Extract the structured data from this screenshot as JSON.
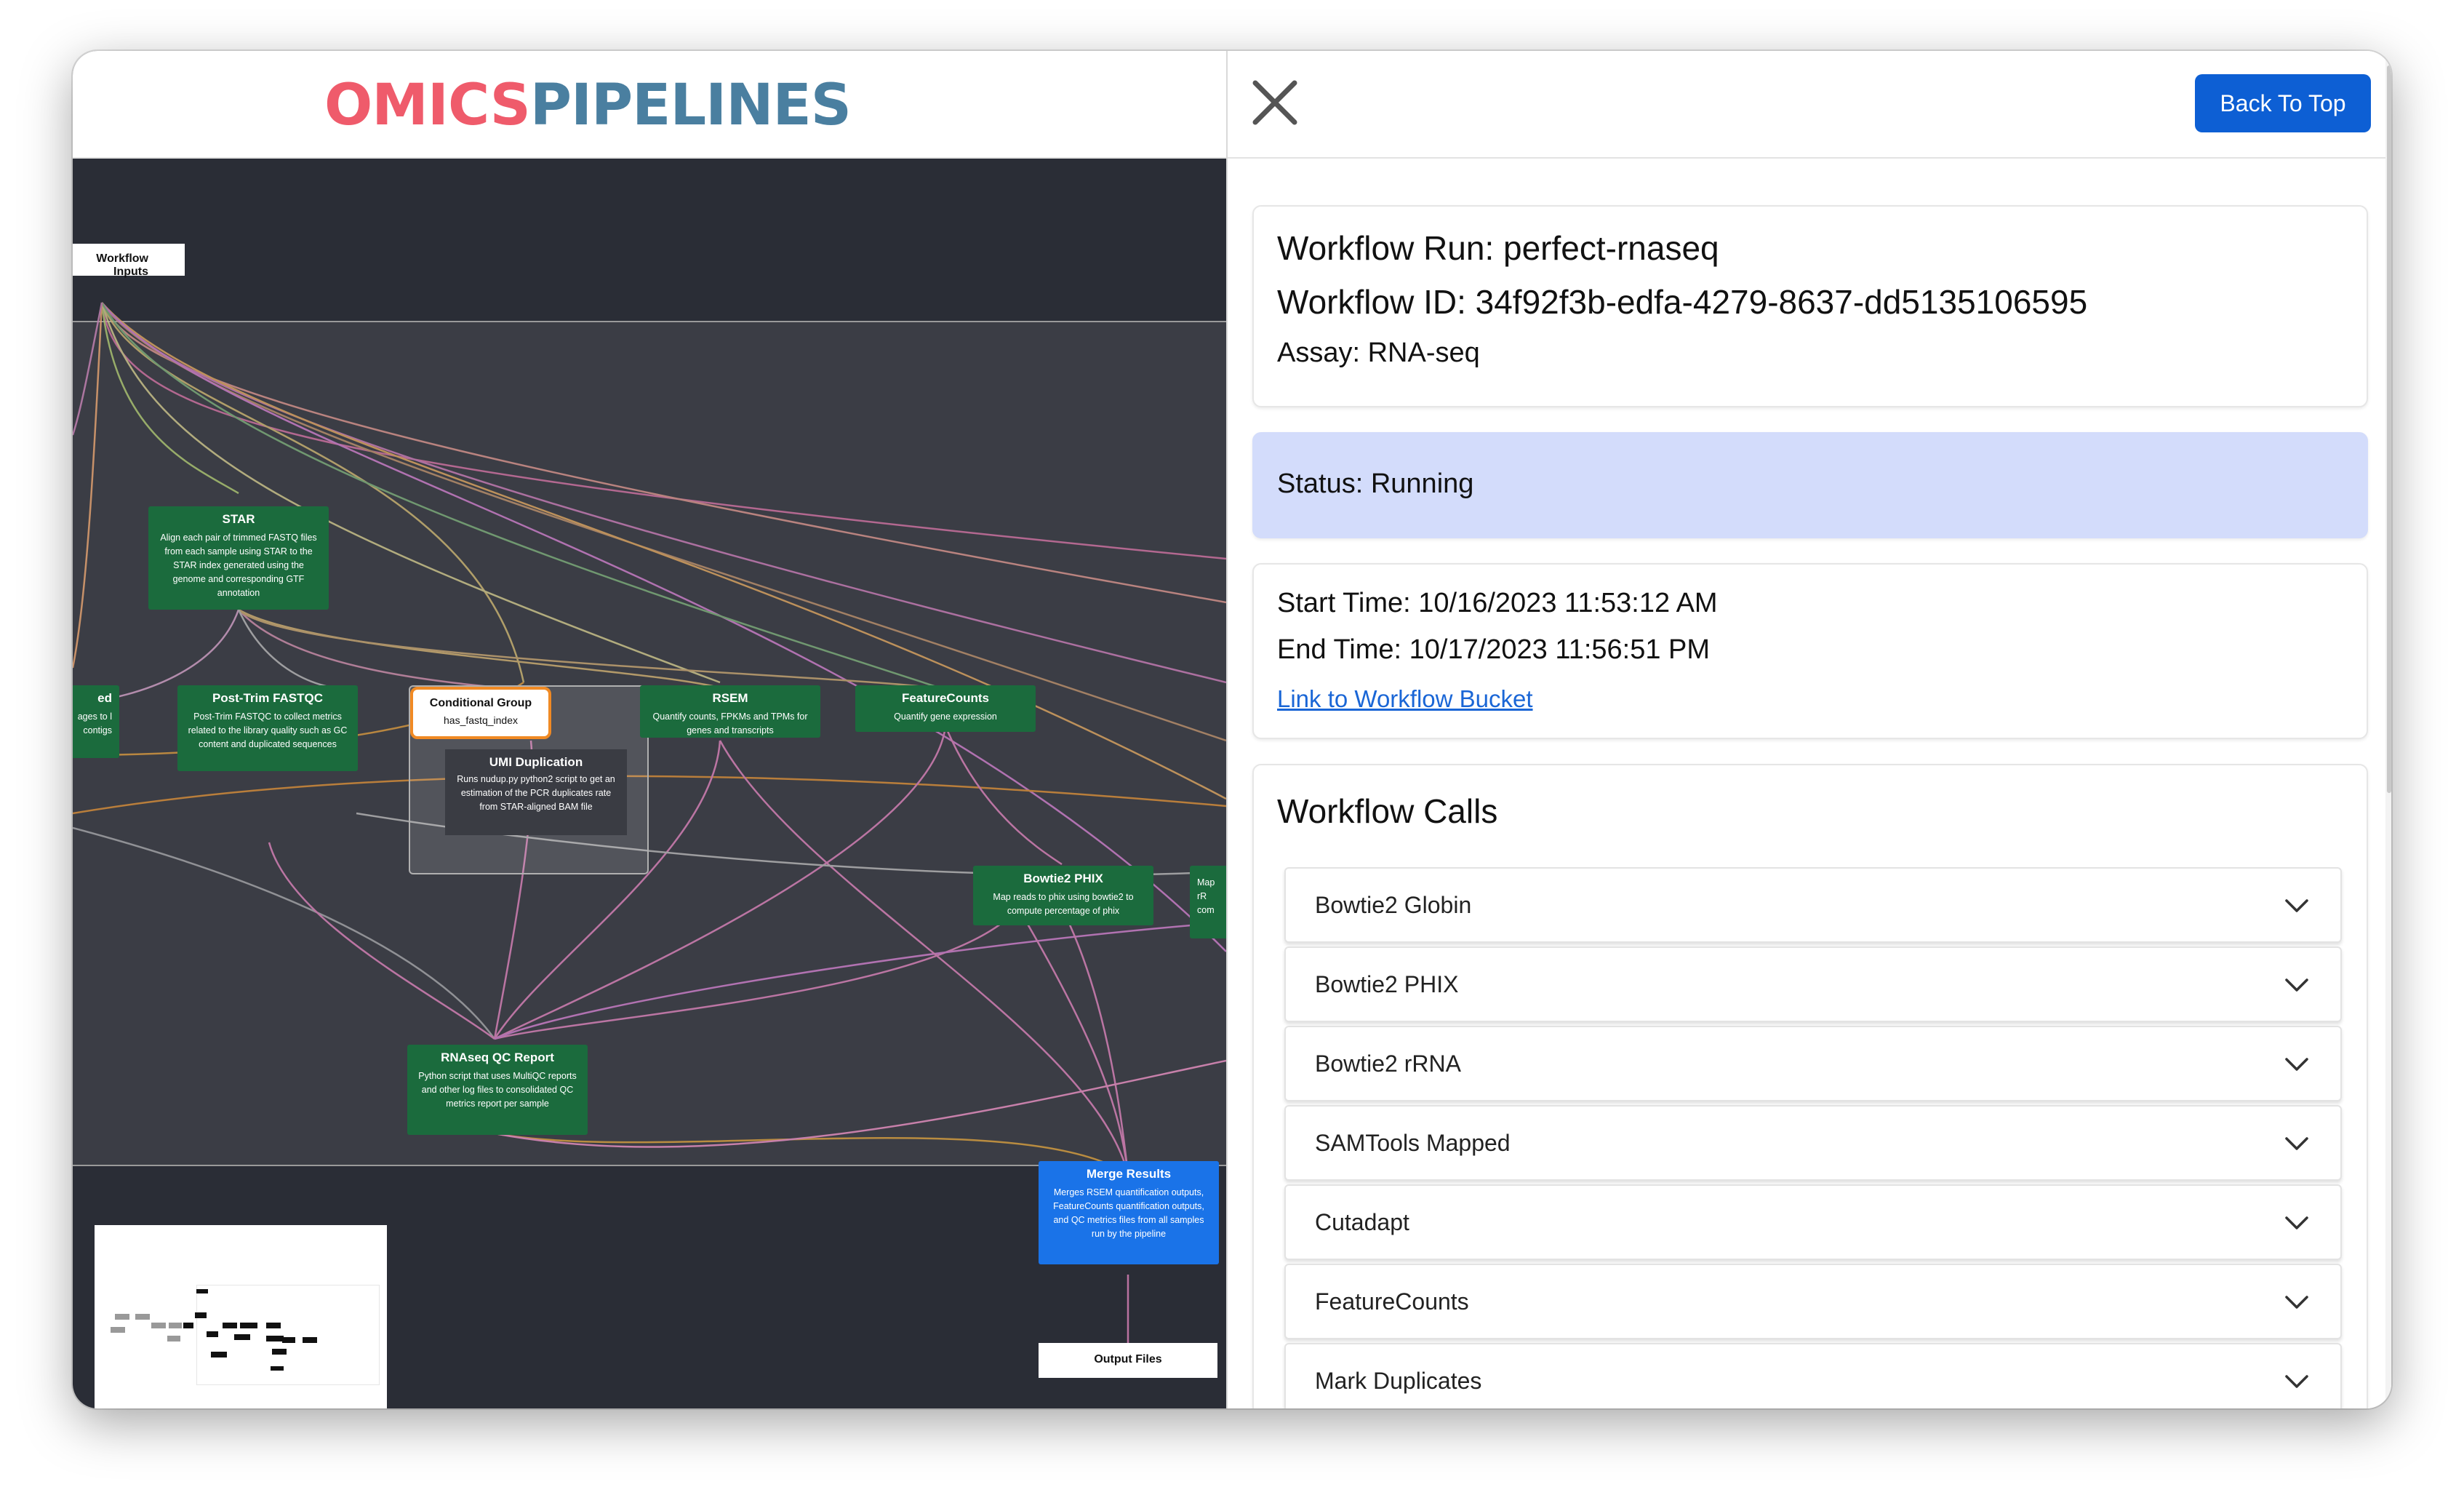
{
  "logo": {
    "part1": "OMICS",
    "part2": "PIPELINES"
  },
  "graph": {
    "inputs_label": "Workflow Inputs",
    "nodes": {
      "star": {
        "title": "STAR",
        "desc": "Align each pair of trimmed FASTQ files from each sample using STAR to the STAR index generated using the genome and corresponding GTF annotation"
      },
      "left_cut": {
        "title": "ed",
        "desc": "ages to l contigs"
      },
      "posttrim": {
        "title": "Post-Trim FASTQC",
        "desc": "Post-Trim FASTQC to collect metrics related to the library quality such as GC content and duplicated sequences"
      },
      "cond": {
        "title": "Conditional Group",
        "desc": "has_fastq_index"
      },
      "umi": {
        "title": "UMI Duplication",
        "desc": "Runs nudup.py python2 script to get an estimation of the PCR duplicates rate from STAR-aligned BAM file"
      },
      "rsem": {
        "title": "RSEM",
        "desc": "Quantify counts, FPKMs and TPMs for genes and transcripts"
      },
      "featurecounts": {
        "title": "FeatureCounts",
        "desc": "Quantify gene expression"
      },
      "bowtie2phix": {
        "title": "Bowtie2 PHIX",
        "desc": "Map reads to phix using bowtie2 to compute percentage of phix"
      },
      "right_cut": {
        "title": "",
        "desc": "Map rR com"
      },
      "rnaseqqc": {
        "title": "RNAseq QC Report",
        "desc": "Python script that uses MultiQC reports and other log files to consolidated QC metrics report per sample"
      },
      "merge": {
        "title": "Merge Results",
        "desc": "Merges RSEM quantification outputs, FeatureCounts quantification outputs, and QC metrics files from all samples run by the pipeline"
      },
      "output": {
        "title": "Output Files"
      }
    }
  },
  "panel": {
    "back_to_top": "Back To Top",
    "run": "Workflow Run: perfect-rnaseq",
    "id": "Workflow ID: 34f92f3b-edfa-4279-8637-dd5135106595",
    "assay": "Assay: RNA-seq",
    "status": "Status: Running",
    "start": "Start Time: 10/16/2023 11:53:12 AM",
    "end": "End Time: 10/17/2023 11:56:51 PM",
    "bucket_link": "Link to Workflow Bucket",
    "calls_title": "Workflow Calls",
    "calls": [
      "Bowtie2 Globin",
      "Bowtie2 PHIX",
      "Bowtie2 rRNA",
      "SAMTools Mapped",
      "Cutadapt",
      "FeatureCounts",
      "Mark Duplicates"
    ]
  },
  "colors": {
    "accent": "#0d5fd4",
    "status_bg": "#d3dcfb",
    "node_green": "#1b6b3d",
    "node_blue": "#1a73e8",
    "logo_red": "#ef5b6b",
    "logo_blue": "#4a7fa0"
  }
}
